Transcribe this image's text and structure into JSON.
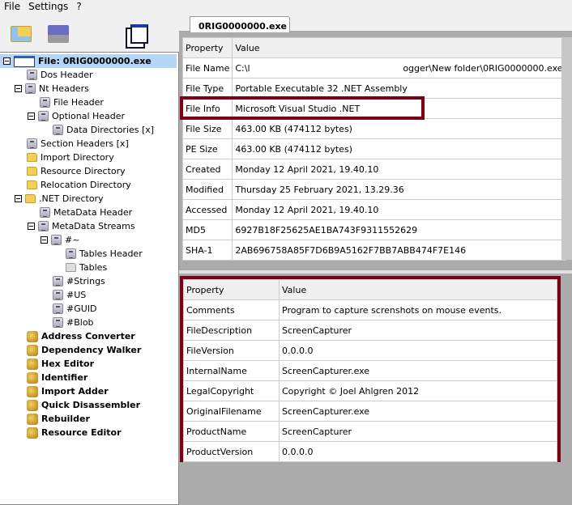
{
  "menu": [
    "File",
    "Settings",
    "?"
  ],
  "toolbar": {
    "open": "open-folder-icon",
    "save": "save-disk-icon",
    "windows": "windows-icon"
  },
  "tab": "0RIG0000000.exe",
  "tree": [
    {
      "label": "File: 0RIG0000000.exe",
      "level": 0,
      "icon": "window",
      "expanded": true,
      "selected": true,
      "bold": true
    },
    {
      "label": "Dos Header",
      "level": 1,
      "icon": "doc"
    },
    {
      "label": "Nt Headers",
      "level": 1,
      "icon": "doc",
      "expanded": true
    },
    {
      "label": "File Header",
      "level": 2,
      "icon": "doc"
    },
    {
      "label": "Optional Header",
      "level": 2,
      "icon": "doc",
      "expanded": true
    },
    {
      "label": "Data Directories [x]",
      "level": 3,
      "icon": "doc"
    },
    {
      "label": "Section Headers [x]",
      "level": 1,
      "icon": "doc"
    },
    {
      "label": "Import Directory",
      "level": 1,
      "icon": "folder"
    },
    {
      "label": "Resource Directory",
      "level": 1,
      "icon": "folder"
    },
    {
      "label": "Relocation Directory",
      "level": 1,
      "icon": "folder"
    },
    {
      "label": ".NET Directory",
      "level": 1,
      "icon": "folder",
      "expanded": true
    },
    {
      "label": "MetaData Header",
      "level": 2,
      "icon": "doc"
    },
    {
      "label": "MetaData Streams",
      "level": 2,
      "icon": "doc",
      "expanded": true
    },
    {
      "label": "#~",
      "level": 3,
      "icon": "doc",
      "expanded": true
    },
    {
      "label": "Tables Header",
      "level": 4,
      "icon": "doc"
    },
    {
      "label": "Tables",
      "level": 4,
      "icon": "folder-gray"
    },
    {
      "label": "#Strings",
      "level": 3,
      "icon": "doc"
    },
    {
      "label": "#US",
      "level": 3,
      "icon": "doc"
    },
    {
      "label": "#GUID",
      "level": 3,
      "icon": "doc"
    },
    {
      "label": "#Blob",
      "level": 3,
      "icon": "doc"
    },
    {
      "label": "Address Converter",
      "level": 1,
      "icon": "tool",
      "bold": true
    },
    {
      "label": "Dependency Walker",
      "level": 1,
      "icon": "tool",
      "bold": true
    },
    {
      "label": "Hex Editor",
      "level": 1,
      "icon": "tool",
      "bold": true
    },
    {
      "label": "Identifier",
      "level": 1,
      "icon": "tool",
      "bold": true
    },
    {
      "label": "Import Adder",
      "level": 1,
      "icon": "tool",
      "bold": true
    },
    {
      "label": "Quick Disassembler",
      "level": 1,
      "icon": "tool",
      "bold": true
    },
    {
      "label": "Rebuilder",
      "level": 1,
      "icon": "tool",
      "bold": true
    },
    {
      "label": "Resource Editor",
      "level": 1,
      "icon": "tool",
      "bold": true
    }
  ],
  "file_table": {
    "headers": [
      "Property",
      "Value"
    ],
    "rows": [
      [
        "File Name",
        "C:\\l                                                      ogger\\New folder\\0RIG0000000.exe"
      ],
      [
        "File Type",
        "Portable Executable 32 .NET Assembly"
      ],
      [
        "File Info",
        "Microsoft Visual Studio .NET"
      ],
      [
        "File Size",
        "463.00 KB (474112 bytes)"
      ],
      [
        "PE Size",
        "463.00 KB (474112 bytes)"
      ],
      [
        "Created",
        "Monday 12 April 2021, 19.40.10"
      ],
      [
        "Modified",
        "Thursday 25 February 2021, 13.29.36"
      ],
      [
        "Accessed",
        "Monday 12 April 2021, 19.40.10"
      ],
      [
        "MD5",
        "6927B18F25625AE1BA743F9311552629"
      ],
      [
        "SHA-1",
        "2AB696758A85F7D6B9A5162F7BB7ABB474F7E146"
      ]
    ]
  },
  "version_table": {
    "headers": [
      "Property",
      "Value"
    ],
    "rows": [
      [
        "Comments",
        "Program to capture screnshots on mouse events."
      ],
      [
        "FileDescription",
        "ScreenCapturer"
      ],
      [
        "FileVersion",
        "0.0.0.0"
      ],
      [
        "InternalName",
        "ScreenCapturer.exe"
      ],
      [
        "LegalCopyright",
        "Copyright © Joel Ahlgren 2012"
      ],
      [
        "OriginalFilename",
        "ScreenCapturer.exe"
      ],
      [
        "ProductName",
        "ScreenCapturer"
      ],
      [
        "ProductVersion",
        "0.0.0.0"
      ]
    ]
  },
  "highlight_color": "#7b0017"
}
